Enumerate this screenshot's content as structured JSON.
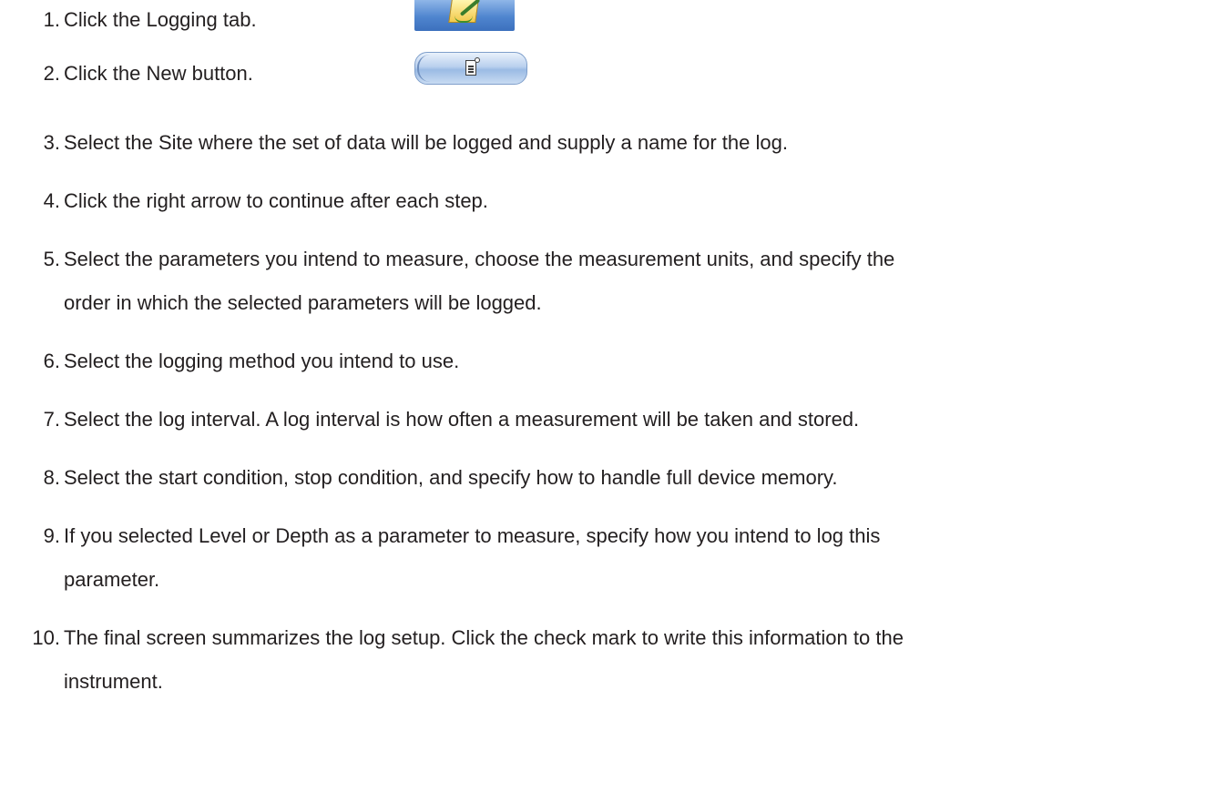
{
  "steps": [
    {
      "num": "1.",
      "text": "Click the Logging tab."
    },
    {
      "num": "2.",
      "text": "Click the New button."
    },
    {
      "num": "3.",
      "text": "Select the Site where the set of data will be logged and supply a name for the log."
    },
    {
      "num": "4.",
      "text": "Click the right arrow to continue after each step."
    },
    {
      "num": "5.",
      "line1": "Select the parameters you intend to measure, choose the measurement units, and specify the",
      "line2": "order in which the selected parameters will be logged."
    },
    {
      "num": "6.",
      "text": "Select the logging method you intend to use."
    },
    {
      "num": "7.",
      "text": "Select the log interval. A log interval is how often a measurement will be taken and stored."
    },
    {
      "num": "8.",
      "text": "Select the start condition, stop condition, and specify how to handle full device memory."
    },
    {
      "num": "9.",
      "line1": "If you selected Level or Depth as a parameter to measure, specify how you intend to log this",
      "line2": "parameter."
    },
    {
      "num": "10.",
      "line1": "The final screen summarizes the log setup. Click the check mark to write this information to the",
      "line2": "instrument."
    }
  ],
  "icons": {
    "logging_tab": "logging-tab-icon",
    "new_button": "new-document-icon"
  }
}
